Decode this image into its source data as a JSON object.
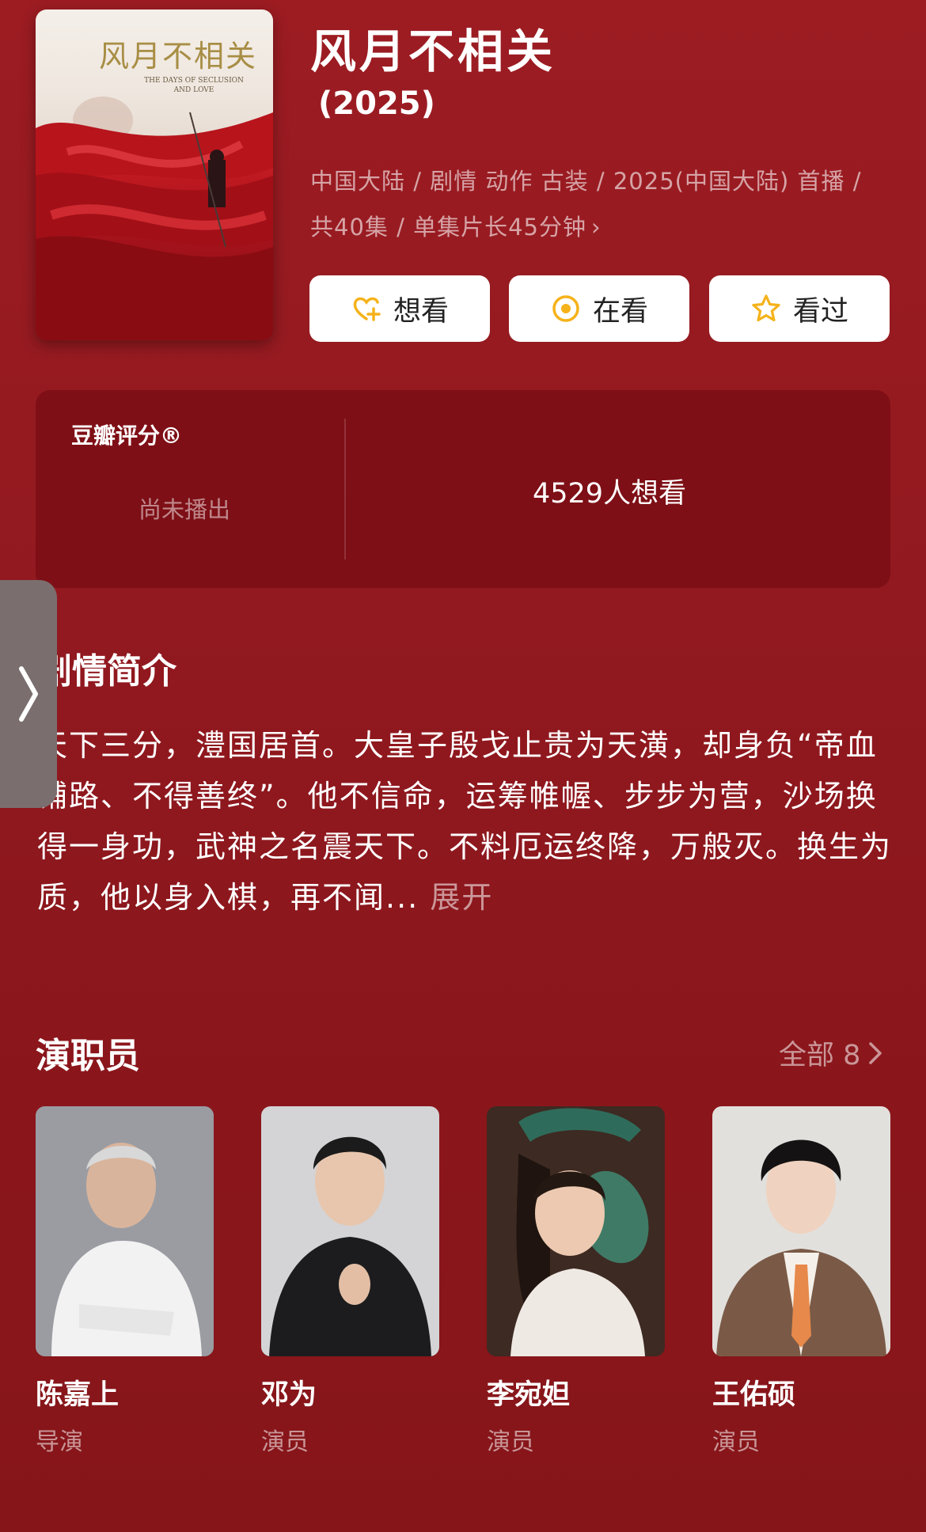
{
  "poster": {
    "title": "风月不相关",
    "subtitle": "THE DAYS OF SECLUSION AND LOVE"
  },
  "show": {
    "title": "风月不相关",
    "year": "(2025)",
    "meta_line1": "中国大陆 / 剧情 动作 古装 / 2025(中国大陆) 首播 /",
    "meta_line2": "共40集 / 单集片长45分钟",
    "meta_chevron": "›"
  },
  "actions": [
    {
      "label": "想看",
      "icon": "heart-plus-icon"
    },
    {
      "label": "在看",
      "icon": "target-icon"
    },
    {
      "label": "看过",
      "icon": "star-icon"
    }
  ],
  "rating": {
    "label": "豆瓣评分®",
    "status": "尚未播出",
    "want_count": "4529人想看"
  },
  "synopsis": {
    "title": "剧情简介",
    "text": "天下三分，澧国居首。大皇子殷戈止贵为天潢，却身负“帝血铺路、不得善终”。他不信命，运筹帷幄、步步为营，沙场换得一身功，武神之名震天下。不料厄运终降，万般灭。换生为质，他以身入棋，再不闻...",
    "expand_label": "展开"
  },
  "cast": {
    "title": "演职员",
    "all_label": "全部 8",
    "members": [
      {
        "name": "陈嘉上",
        "role": "导演"
      },
      {
        "name": "邓为",
        "role": "演员"
      },
      {
        "name": "李宛妲",
        "role": "演员"
      },
      {
        "name": "王佑硕",
        "role": "演员"
      }
    ]
  },
  "colors": {
    "background": "#941a20",
    "accent_yellow": "#f5b21a",
    "button_bg": "#ffffff"
  }
}
